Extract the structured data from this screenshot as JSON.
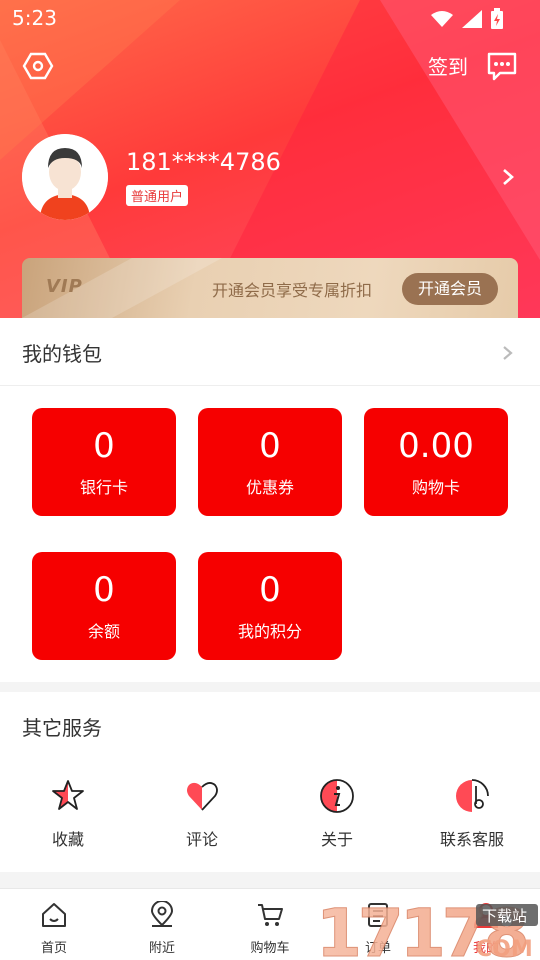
{
  "status": {
    "time": "5:23"
  },
  "header": {
    "checkin_label": "签到"
  },
  "profile": {
    "phone": "181****4786",
    "badge": "普通用户"
  },
  "vip": {
    "logo_text": "VIP",
    "description": "开通会员享受专属折扣",
    "open_button": "开通会员"
  },
  "wallet": {
    "title": "我的钱包",
    "cards": [
      {
        "value": "0",
        "label": "银行卡"
      },
      {
        "value": "0",
        "label": "优惠券"
      },
      {
        "value": "0.00",
        "label": "购物卡"
      },
      {
        "value": "0",
        "label": "余额"
      },
      {
        "value": "0",
        "label": "我的积分"
      }
    ]
  },
  "services": {
    "title": "其它服务",
    "items": [
      {
        "label": "收藏",
        "icon": "star-icon"
      },
      {
        "label": "评论",
        "icon": "heart-icon"
      },
      {
        "label": "关于",
        "icon": "info-icon"
      },
      {
        "label": "联系客服",
        "icon": "headset-icon"
      }
    ]
  },
  "tabbar": {
    "items": [
      {
        "label": "首页",
        "icon": "home-icon"
      },
      {
        "label": "附近",
        "icon": "location-icon"
      },
      {
        "label": "购物车",
        "icon": "cart-icon"
      },
      {
        "label": "订单",
        "icon": "order-icon"
      },
      {
        "label": "我的",
        "icon": "profile-icon",
        "active": true
      }
    ]
  },
  "watermark": {
    "text": "17178",
    "sub": "下载站",
    "suffix": "COM"
  },
  "colors": {
    "accent": "#f60000",
    "header_red": "#ff3a3a",
    "vip_gold": "#9a7252"
  }
}
